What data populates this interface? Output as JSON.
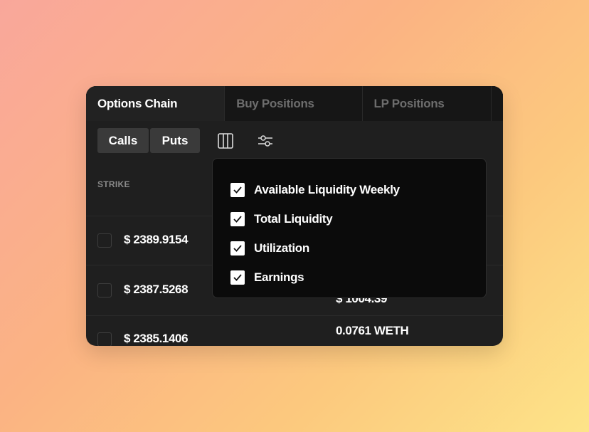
{
  "tabs": [
    "Options Chain",
    "Buy Positions",
    "LP Positions"
  ],
  "toolbar": {
    "calls": "Calls",
    "puts": "Puts",
    "columns_icon": "columns-icon",
    "filters_icon": "sliders-icon"
  },
  "table": {
    "header": "STRIKE",
    "rows": [
      {
        "strike": "$ 2389.9154",
        "value": ""
      },
      {
        "strike": "$ 2387.5268",
        "value": "$ 1004.39"
      },
      {
        "strike": "$ 2385.1406",
        "value": "0.0761 WETH"
      }
    ]
  },
  "menu": {
    "items": [
      {
        "label": "Available Liquidity Weekly",
        "checked": true
      },
      {
        "label": "Total Liquidity",
        "checked": true
      },
      {
        "label": "Utilization",
        "checked": true
      },
      {
        "label": "Earnings",
        "checked": true
      }
    ]
  }
}
